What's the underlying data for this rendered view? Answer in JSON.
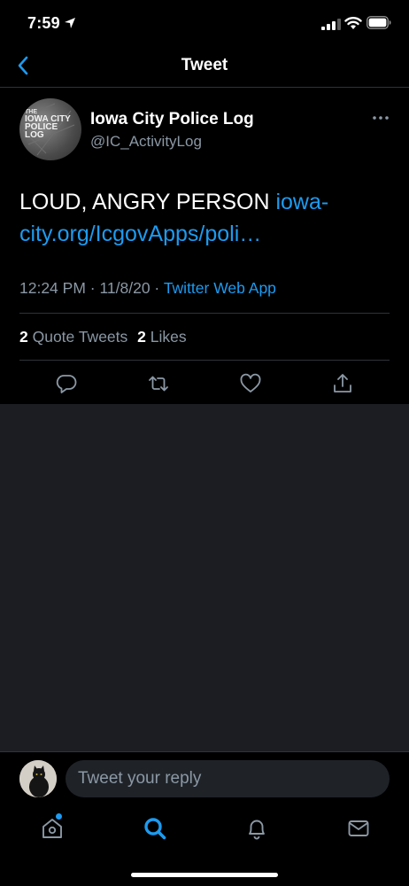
{
  "status_bar": {
    "time": "7:59"
  },
  "nav": {
    "title": "Tweet"
  },
  "tweet": {
    "author_name": "Iowa City Police Log",
    "author_handle": "@IC_ActivityLog",
    "avatar_text": [
      "THE",
      "IOWA CITY",
      "POLICE",
      "LOG"
    ],
    "text": "LOUD, ANGRY PERSON ",
    "link_text": "iowa-city.org/IcgovApps/poli…",
    "time": "12:24 PM",
    "separator": " · ",
    "date": "11/8/20",
    "source": "Twitter Web App",
    "quote_count": "2",
    "quote_label": "Quote Tweets",
    "like_count": "2",
    "like_label": "Likes"
  },
  "reply": {
    "placeholder": "Tweet your reply"
  },
  "icons": {
    "back": "chevron-left-icon",
    "more": "more-icon",
    "reply": "reply-icon",
    "retweet": "retweet-icon",
    "like": "heart-icon",
    "share": "share-icon",
    "home": "home-icon",
    "search": "search-icon",
    "notifications": "bell-icon",
    "messages": "mail-icon"
  },
  "colors": {
    "accent": "#1d9bf0",
    "secondary_text": "#8b98a5",
    "background": "#000000",
    "empty_area": "#1c1d22"
  }
}
